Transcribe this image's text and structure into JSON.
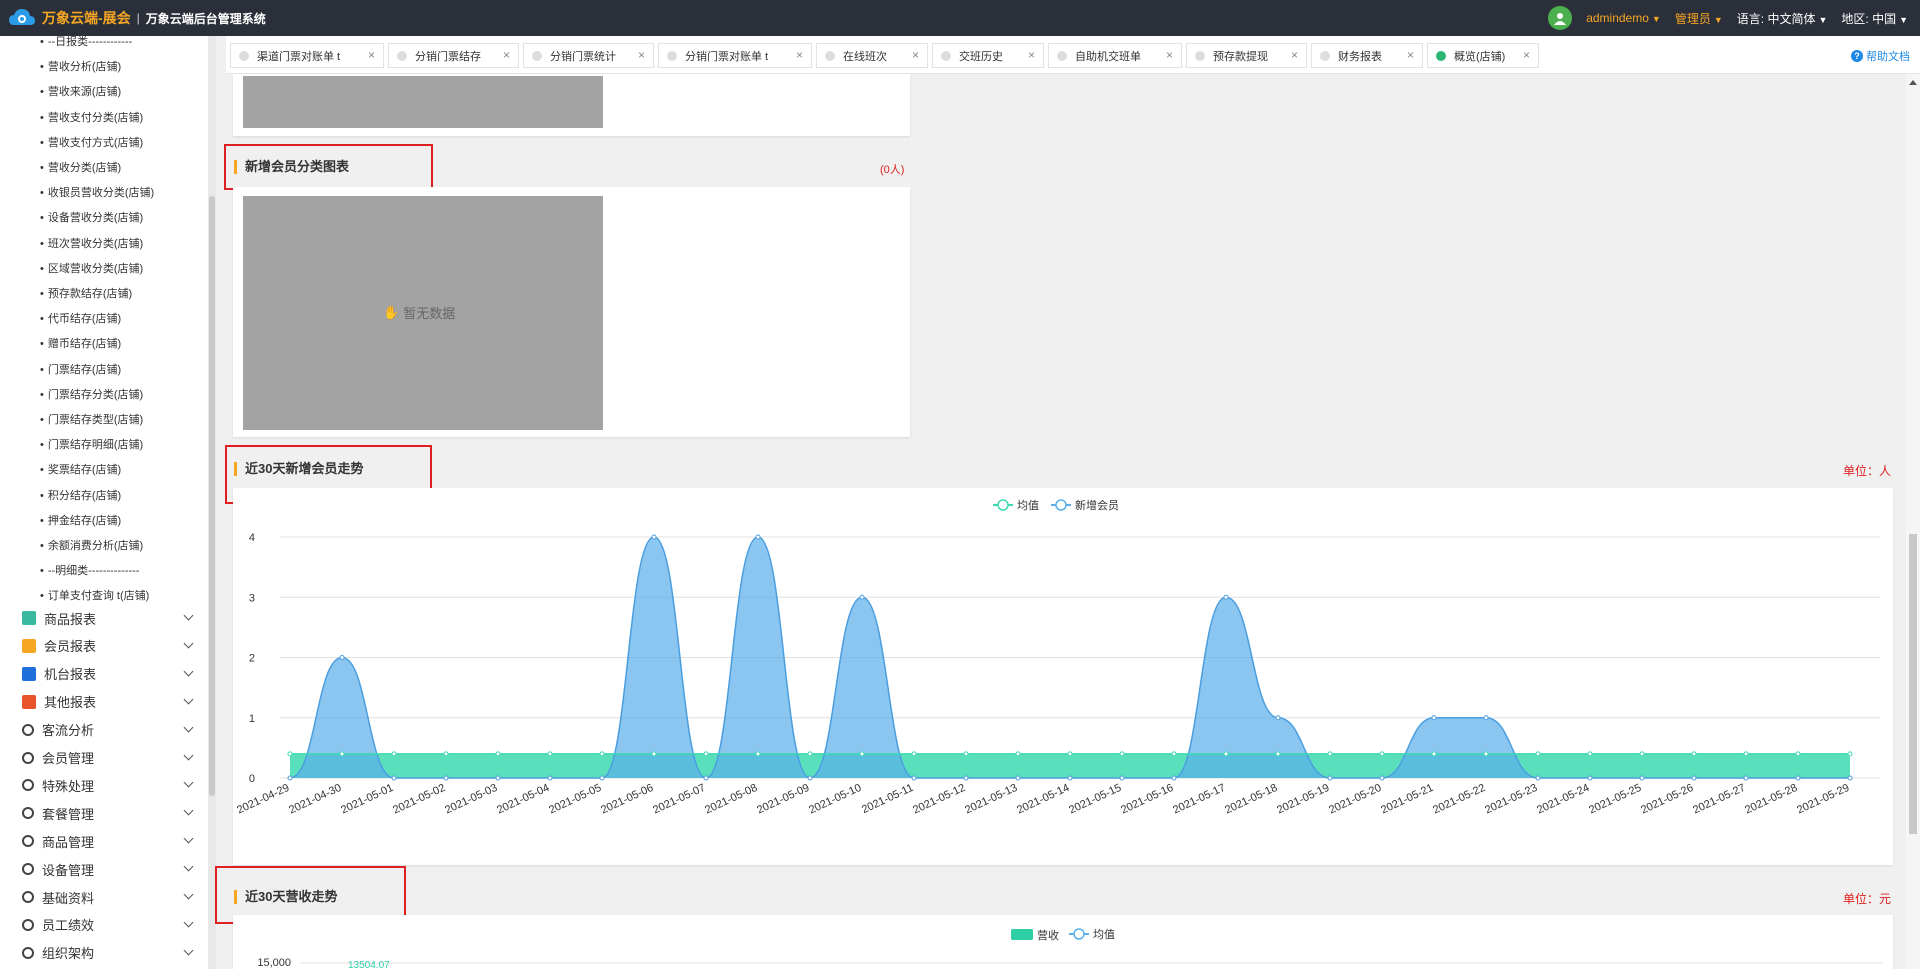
{
  "header": {
    "brand": "万象云端-展会",
    "separator": "|",
    "system_name": "万象云端后台管理系统",
    "username": "admindemo",
    "role": "管理员",
    "language_label": "语言:",
    "language_value": "中文简体",
    "region_label": "地区:",
    "region_value": "中国"
  },
  "sidebar": {
    "sub_items": [
      "--日报类------------",
      "营收分析(店铺)",
      "营收来源(店铺)",
      "营收支付分类(店铺)",
      "营收支付方式(店铺)",
      "营收分类(店铺)",
      "收银员营收分类(店铺)",
      "设备营收分类(店铺)",
      "班次营收分类(店铺)",
      "区域营收分类(店铺)",
      "预存款结存(店铺)",
      "代币结存(店铺)",
      "赠币结存(店铺)",
      "门票结存(店铺)",
      "门票结存分类(店铺)",
      "门票结存类型(店铺)",
      "门票结存明细(店铺)",
      "奖票结存(店铺)",
      "积分结存(店铺)",
      "押金结存(店铺)",
      "余额消费分析(店铺)",
      "--明细类--------------",
      "订单支付查询 t(店铺)"
    ],
    "sections": [
      {
        "label": "商品报表",
        "icon": "product-report-icon",
        "color": "#3bb8a0"
      },
      {
        "label": "会员报表",
        "icon": "member-report-icon",
        "color": "#f5a623"
      },
      {
        "label": "机台报表",
        "icon": "machine-report-icon",
        "color": "#1e6fd9"
      },
      {
        "label": "其他报表",
        "icon": "layers-icon",
        "color": "#e8552a"
      },
      {
        "label": "客流分析",
        "icon": "target-icon",
        "color": "#444"
      },
      {
        "label": "会员管理",
        "icon": "user-icon",
        "color": "#444"
      },
      {
        "label": "特殊处理",
        "icon": "warning-icon",
        "color": "#444"
      },
      {
        "label": "套餐管理",
        "icon": "package-icon",
        "color": "#444"
      },
      {
        "label": "商品管理",
        "icon": "exchange-icon",
        "color": "#444"
      },
      {
        "label": "设备管理",
        "icon": "device-icon",
        "color": "#444"
      },
      {
        "label": "基础资料",
        "icon": "document-icon",
        "color": "#444"
      },
      {
        "label": "员工绩效",
        "icon": "gear-icon",
        "color": "#444"
      },
      {
        "label": "组织架构",
        "icon": "org-icon",
        "color": "#444"
      }
    ]
  },
  "tabs": [
    {
      "label": "渠道门票对账单 t",
      "active": false
    },
    {
      "label": "分销门票结存",
      "active": false
    },
    {
      "label": "分销门票统计",
      "active": false
    },
    {
      "label": "分销门票对账单 t",
      "active": false
    },
    {
      "label": "在线班次",
      "active": false
    },
    {
      "label": "交班历史",
      "active": false
    },
    {
      "label": "自助机交班单",
      "active": false
    },
    {
      "label": "预存款提现",
      "active": false
    },
    {
      "label": "财务报表",
      "active": false
    },
    {
      "label": "概览(店铺)",
      "active": true
    }
  ],
  "help_label": "帮助文档",
  "sections": {
    "member_category": {
      "title": "新增会员分类图表",
      "count": "(0人)",
      "no_data": "暂无数据"
    },
    "member_trend": {
      "title": "近30天新增会员走势",
      "unit": "单位：人"
    },
    "revenue_trend": {
      "title": "近30天营收走势",
      "unit": "单位：元"
    }
  },
  "chart_data": [
    {
      "type": "area",
      "legend": [
        "均值",
        "新增会员"
      ],
      "legend_position": "top-center",
      "ylim": [
        0,
        4
      ],
      "yticks": [
        "0",
        "1",
        "2",
        "3",
        "4"
      ],
      "x": [
        "2021-04-29",
        "2021-04-30",
        "2021-05-01",
        "2021-05-02",
        "2021-05-03",
        "2021-05-04",
        "2021-05-05",
        "2021-05-06",
        "2021-05-07",
        "2021-05-08",
        "2021-05-09",
        "2021-05-10",
        "2021-05-11",
        "2021-05-12",
        "2021-05-13",
        "2021-05-14",
        "2021-05-15",
        "2021-05-16",
        "2021-05-17",
        "2021-05-18",
        "2021-05-19",
        "2021-05-20",
        "2021-05-21",
        "2021-05-22",
        "2021-05-23",
        "2021-05-24",
        "2021-05-25",
        "2021-05-26",
        "2021-05-27",
        "2021-05-28",
        "2021-05-29"
      ],
      "series": [
        {
          "name": "均值",
          "color": "#3dd9b0",
          "values": [
            0.4,
            0.4,
            0.4,
            0.4,
            0.4,
            0.4,
            0.4,
            0.4,
            0.4,
            0.4,
            0.4,
            0.4,
            0.4,
            0.4,
            0.4,
            0.4,
            0.4,
            0.4,
            0.4,
            0.4,
            0.4,
            0.4,
            0.4,
            0.4,
            0.4,
            0.4,
            0.4,
            0.4,
            0.4,
            0.4,
            0.4
          ]
        },
        {
          "name": "新增会员",
          "color": "#5aaeea",
          "values": [
            0,
            2,
            0,
            0,
            0,
            0,
            0,
            4,
            0,
            4,
            0,
            3,
            0,
            0,
            0,
            0,
            0,
            0,
            3,
            1,
            0,
            0,
            1,
            1,
            0,
            0,
            0,
            0,
            0,
            0,
            0
          ]
        }
      ],
      "grid": true
    },
    {
      "type": "bar",
      "legend": [
        "营收",
        "均值"
      ],
      "legend_position": "top-center",
      "yticks": [
        "15,000"
      ],
      "annotation": "13504.07"
    }
  ]
}
